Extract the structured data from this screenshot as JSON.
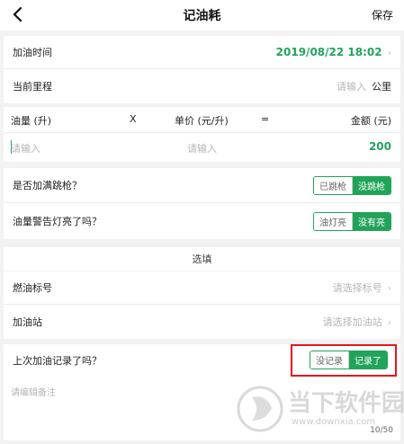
{
  "header": {
    "title": "记油耗",
    "save": "保存"
  },
  "fuel_time": {
    "label": "加油时间",
    "value": "2019/08/22 18:02"
  },
  "mileage": {
    "label": "当前里程",
    "placeholder": "请输入",
    "unit": "公里"
  },
  "fuel_table": {
    "col_amount": "油量 (升)",
    "op_multiply": "X",
    "col_price": "单价 (元/升)",
    "op_equals": "=",
    "col_total": "金额 (元)",
    "amount_placeholder": "请输入",
    "price_placeholder": "请输入",
    "total_value": "200"
  },
  "full_tank": {
    "label": "是否加满跳枪？",
    "opt_off": "已跳枪",
    "opt_on": "没跳枪"
  },
  "warning_light": {
    "label": "油量警告灯亮了吗？",
    "opt_off": "油灯亮",
    "opt_on": "没有亮"
  },
  "optional_section": {
    "title": "选填"
  },
  "fuel_grade": {
    "label": "燃油标号",
    "placeholder": "请选择标号"
  },
  "gas_station": {
    "label": "加油站",
    "placeholder": "请选择加油站"
  },
  "last_recorded": {
    "label": "上次加油记录了吗？",
    "opt_off": "没记录",
    "opt_on": "记录了"
  },
  "note": {
    "placeholder": "请编辑备注",
    "counter": "10/50"
  },
  "watermark": {
    "brand": "当下软件园",
    "url": "www.downxia.com"
  },
  "colors": {
    "accent": "#22a35a",
    "highlight": "#e8141b"
  }
}
